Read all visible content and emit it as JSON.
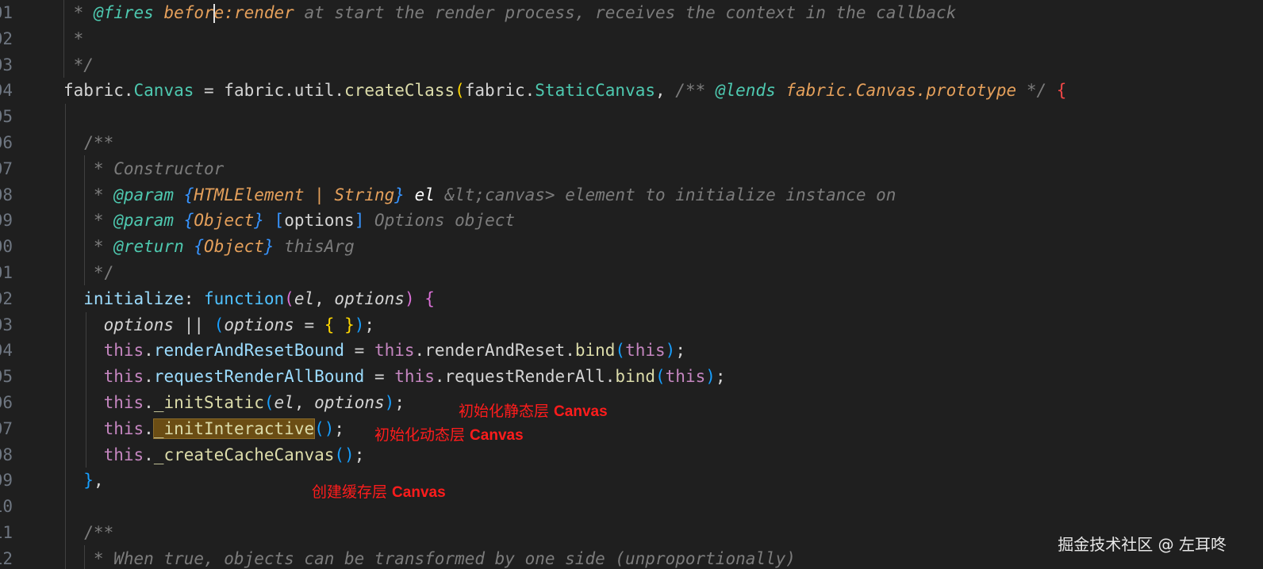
{
  "gutter": {
    "line_numbers": [
      "01",
      "02",
      "03",
      "04",
      "05",
      "06",
      "07",
      "08",
      "09",
      "00",
      "01",
      "02",
      "03",
      "04",
      "05",
      "06",
      "07",
      "08",
      "09",
      "10",
      "11",
      "12"
    ]
  },
  "code": {
    "l01": {
      "star": " * ",
      "tag": "@fires",
      "name": " before",
      "name2": ":render",
      "rest": " at start the render process, receives the context in the callback"
    },
    "l02": {
      "text": " *"
    },
    "l03": {
      "text": " */"
    },
    "l04": {
      "a": "fabric.",
      "b": "Canvas",
      "c": " = fabric.util.",
      "d": "createClass",
      "e": "(",
      "f": "fabric.",
      "g": "StaticCanvas",
      "h": ", ",
      "i": "/** ",
      "j": "@lends",
      "k": " fabric.Canvas.prototype",
      "l": " */",
      "m": " {"
    },
    "l06": {
      "text": "  /**"
    },
    "l07": {
      "text": "   * Constructor"
    },
    "l08": {
      "star": "   * ",
      "tag": "@param",
      "sp": " ",
      "brace1": "{",
      "type": "HTMLElement | String",
      "brace2": "}",
      "name": " el",
      "rest": " &lt;canvas> element to initialize instance on"
    },
    "l09": {
      "star": "   * ",
      "tag": "@param",
      "sp": " ",
      "brace1": "{",
      "type": "Object",
      "brace2": "}",
      "b3": " [",
      "name": "options",
      "b4": "]",
      "rest": " Options object"
    },
    "l10": {
      "star": "   * ",
      "tag": "@return",
      "sp": " ",
      "brace1": "{",
      "type": "Object",
      "brace2": "}",
      "rest": " thisArg"
    },
    "l11": {
      "text": "   */"
    },
    "l12": {
      "a": "  initialize",
      "b": ": ",
      "c": "function",
      "d": "(",
      "e": "el",
      "f": ", ",
      "g": "options",
      "h": ")",
      "i": " {"
    },
    "l13": {
      "a": "    ",
      "b": "options",
      "c": " || ",
      "d": "(",
      "e": "options",
      "f": " = ",
      "g": "{ }",
      "h": ")",
      "i": ";"
    },
    "l14": {
      "a": "    ",
      "b": "this",
      "c": ".",
      "d": "renderAndResetBound",
      "e": " = ",
      "f": "this",
      "g": ".renderAndReset.",
      "h": "bind",
      "i": "(",
      "j": "this",
      "k": ")",
      "l": ";"
    },
    "l15": {
      "a": "    ",
      "b": "this",
      "c": ".",
      "d": "requestRenderAllBound",
      "e": " = ",
      "f": "this",
      "g": ".requestRenderAll.",
      "h": "bind",
      "i": "(",
      "j": "this",
      "k": ")",
      "l": ";"
    },
    "l16": {
      "a": "    ",
      "b": "this",
      "c": ".",
      "d": "_initStatic",
      "e": "(",
      "f": "el",
      "g": ", ",
      "h": "options",
      "i": ")",
      "j": ";"
    },
    "l17": {
      "a": "    ",
      "b": "this",
      "c": ".",
      "d": "_initInteractive",
      "e": "()",
      "f": ";"
    },
    "l18": {
      "a": "    ",
      "b": "this",
      "c": ".",
      "d": "_createCacheCanvas",
      "e": "()",
      "f": ";"
    },
    "l19": {
      "a": "  }",
      "b": ","
    },
    "l21": {
      "text": "  /**"
    },
    "l22": {
      "text": "   * When true, objects can be transformed by one side (unproportionally)"
    }
  },
  "annotations": {
    "static_cn": "初始化静态层 ",
    "static_en": "Canvas",
    "interactive_cn": "初始化动态层 ",
    "interactive_en": "Canvas",
    "cache_cn": "创建缓存层 ",
    "cache_en": "Canvas"
  },
  "watermark": "掘金技术社区 @ 左耳咚"
}
